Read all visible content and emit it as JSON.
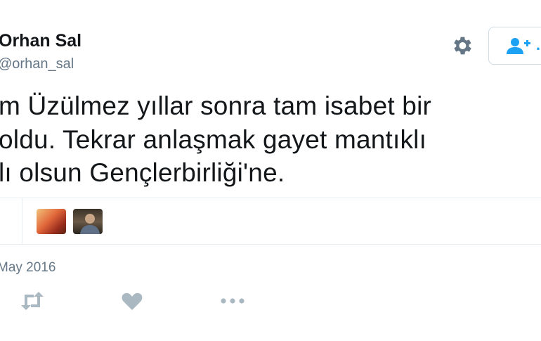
{
  "author": {
    "name": "Orhan Sal",
    "handle": "@orhan_sal"
  },
  "header": {
    "follow_label": "…"
  },
  "tweet": {
    "lines": [
      "m Üzülmez yıllar sonra tam isabet bir",
      "oldu. Tekrar anlaşmak gayet mantıklı",
      "lı olsun Gençlerbirliği'ne."
    ]
  },
  "likers": [
    "avatar-1",
    "avatar-2"
  ],
  "meta": {
    "date": "May 2016"
  },
  "actions": [
    "retweet-icon",
    "heart-icon",
    "more-icon"
  ],
  "colors": {
    "accent": "#1da1f2",
    "muted": "#657786",
    "icon": "#aab8c2",
    "border": "#e6ecf0"
  }
}
